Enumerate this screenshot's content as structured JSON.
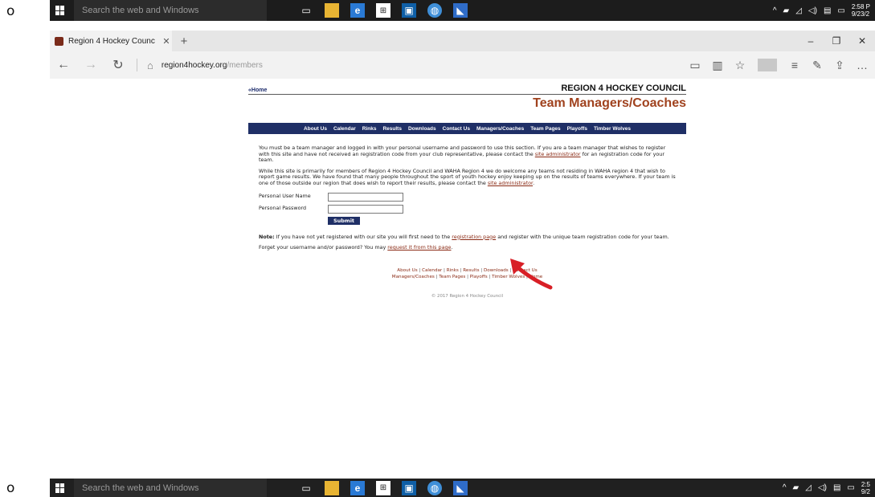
{
  "margin_marks": {
    "top": "o",
    "bottom": "o"
  },
  "taskbar": {
    "search_placeholder": "Search the web and Windows",
    "apps": [
      "task-view-icon",
      "file-explorer-icon",
      "edge-icon",
      "store-icon",
      "media-icon",
      "globe-icon",
      "accessibility-icon"
    ],
    "tray": {
      "time": "2:58 P",
      "date": "9/23/2"
    },
    "bottom_tray": {
      "time": "2:5",
      "date": "9/2"
    }
  },
  "browser": {
    "tab_title": "Region 4 Hockey Counc",
    "url_host": "region4hockey.org",
    "url_path": "/members"
  },
  "site": {
    "home_link": "«Home",
    "brand": "REGION 4 HOCKEY COUNCIL",
    "page_title": "Team Managers/Coaches",
    "menu": [
      "About Us",
      "Calendar",
      "Rinks",
      "Results",
      "Downloads",
      "Contact Us",
      "Managers/Coaches",
      "Team Pages",
      "Playoffs",
      "Timber Wolves"
    ],
    "para1_text": "You must be a team manager and logged in with your personal username and password to use this section. If you are a team manager that wishes to register with this site and have not received an registration code from your club representative, please contact the ",
    "para1_link": "site administrator",
    "para1_end": " for an registration code for your team.",
    "para2_text": "While this site is primarily for members of Region 4 Hockey Council and WAHA Region 4 we do welcome any teams not residing in WAHA region 4 that wish to report game results. We have found that many people throughout the sport of youth hockey enjoy keeping up on the results of teams everywhere. If your team is one of those outside our region that does wish to report their results, please contact the ",
    "para2_link": "site administrator",
    "para2_end": ".",
    "username_label": "Personal User Name",
    "password_label": "Personal Password",
    "submit_label": "Submit",
    "note_label": "Note:",
    "note_text": " If you have not yet registered with our site you will first need to the ",
    "note_link": "registration page",
    "note_end": " and register with the unique team registration code for your team.",
    "forgot_text": "Forget your username and/or password? You may ",
    "forgot_link": "request it from this page",
    "forgot_end": ".",
    "footer_line1": [
      "About Us",
      "Calendar",
      "Rinks",
      "Results",
      "Downloads",
      "Contact Us"
    ],
    "footer_line2": [
      "Managers/Coaches",
      "Team Pages",
      "Playoffs",
      "Timber Wolves",
      "Home"
    ],
    "copyright": "© 2017 Region 4 Hockey Council"
  },
  "colors": {
    "menu_bg": "#1f2f66",
    "title": "#a0421e",
    "link": "#8a2a14",
    "arrow": "#d81f26"
  }
}
